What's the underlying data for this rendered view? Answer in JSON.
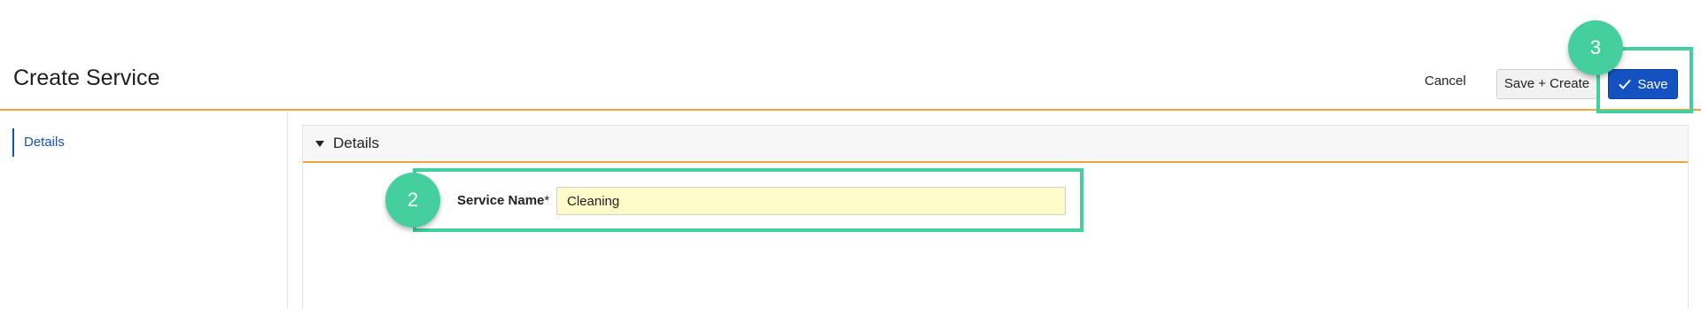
{
  "header": {
    "title": "Create Service",
    "cancel_label": "Cancel",
    "save_create_label": "Save + Create",
    "save_label": "Save",
    "save_icon": "checkmark-icon"
  },
  "sidebar": {
    "items": [
      {
        "label": "Details"
      }
    ]
  },
  "panel": {
    "title": "Details",
    "caret_icon": "caret-down-icon"
  },
  "form": {
    "service_name_label": "Service Name",
    "required_marker": "*",
    "service_name_value": "Cleaning"
  },
  "annotations": {
    "step_field": "2",
    "step_save": "3",
    "highlight_color": "#45cf9f"
  },
  "colors": {
    "accent_orange": "#f0a23c",
    "primary_blue": "#1552c1",
    "input_highlight": "#fdfcc9"
  }
}
